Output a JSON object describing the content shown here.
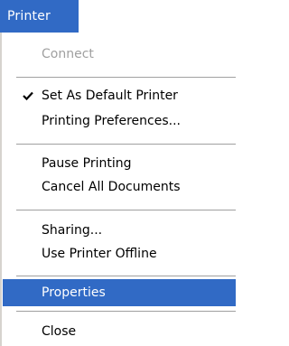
{
  "menu": {
    "title": "Printer",
    "items": [
      {
        "label": "Connect",
        "enabled": false
      },
      {
        "label": "Set As Default Printer",
        "checked": true
      },
      {
        "label": "Printing Preferences..."
      },
      {
        "label": "Pause Printing"
      },
      {
        "label": "Cancel All Documents"
      },
      {
        "label": "Sharing..."
      },
      {
        "label": "Use Printer Offline"
      },
      {
        "label": "Properties",
        "highlighted": true
      },
      {
        "label": "Close"
      }
    ],
    "highlight_color": "#316ac5",
    "checkmark_icon": "checkmark-icon"
  }
}
